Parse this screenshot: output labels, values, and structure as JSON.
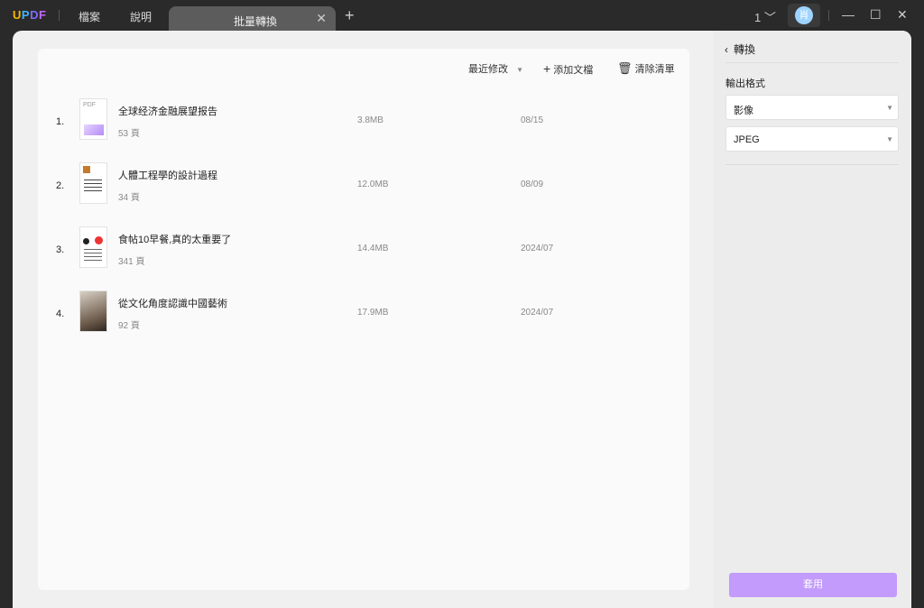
{
  "app": {
    "logo": "UPDF",
    "menu": [
      "檔案",
      "說明"
    ],
    "tab": "批量轉換",
    "page_indicator": "1",
    "avatar": "肖"
  },
  "toolbar": {
    "sort": "最近修改",
    "add": "添加文檔",
    "clear": "清除清單"
  },
  "files": [
    {
      "index": "1.",
      "name": "全球经济金融展望报告",
      "pages": "53 頁",
      "size": "3.8MB",
      "date": "08/15"
    },
    {
      "index": "2.",
      "name": "人體工程學的設計過程",
      "pages": "34 頁",
      "size": "12.0MB",
      "date": "08/09"
    },
    {
      "index": "3.",
      "name": "食帖10早餐,真的太重要了",
      "pages": "341 頁",
      "size": "14.4MB",
      "date": "2024/07"
    },
    {
      "index": "4.",
      "name": "從文化角度認識中國藝術",
      "pages": "92 頁",
      "size": "17.9MB",
      "date": "2024/07"
    }
  ],
  "panel": {
    "title": "轉換",
    "output_label": "輸出格式",
    "format": "影像",
    "image_type": "JPEG",
    "apply": "套用"
  },
  "colors": {
    "accent": "#c29bfc"
  }
}
